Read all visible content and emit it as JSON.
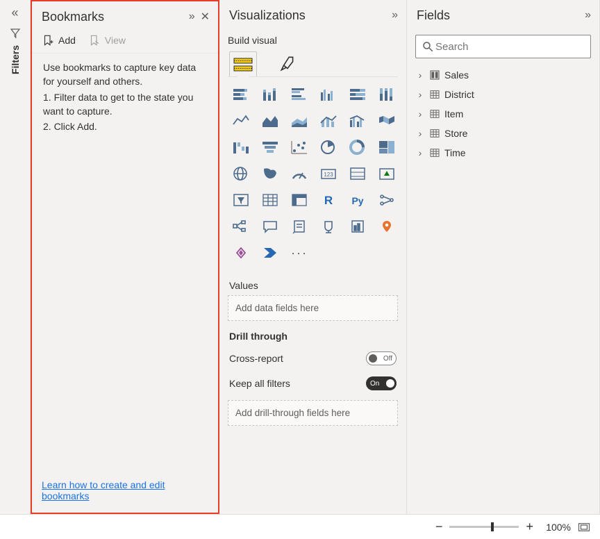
{
  "filters": {
    "label": "Filters"
  },
  "bookmarks": {
    "title": "Bookmarks",
    "add": "Add",
    "view": "View",
    "help_intro": "Use bookmarks to capture key data for yourself and others.",
    "help_step1": "1. Filter data to get to the state you want to capture.",
    "help_step2": "2. Click Add.",
    "link_text": "Learn how to create and edit bookmarks"
  },
  "viz": {
    "title": "Visualizations",
    "build_label": "Build visual",
    "values_label": "Values",
    "values_placeholder": "Add data fields here",
    "drill_label": "Drill through",
    "cross_report": "Cross-report",
    "cross_report_state": "Off",
    "keep_filters": "Keep all filters",
    "keep_filters_state": "On",
    "drill_placeholder": "Add drill-through fields here"
  },
  "fields": {
    "title": "Fields",
    "search_placeholder": "Search",
    "tables": [
      "Sales",
      "District",
      "Item",
      "Store",
      "Time"
    ]
  },
  "footer": {
    "zoom": "100%"
  }
}
